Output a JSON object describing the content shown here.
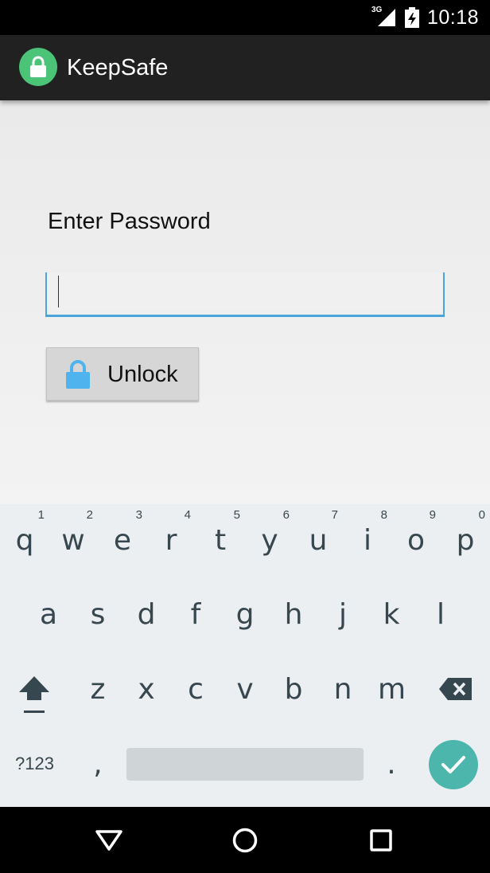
{
  "status_bar": {
    "network": "3G",
    "time": "10:18"
  },
  "app_bar": {
    "title": "KeepSafe",
    "logo_icon": "lock-icon",
    "logo_color": "#4cc478"
  },
  "unlock_screen": {
    "prompt": "Enter Password",
    "password_value": "",
    "unlock_label": "Unlock",
    "unlock_icon": "lock-icon",
    "accent_color": "#4aa3d9"
  },
  "keyboard": {
    "row1": [
      {
        "key": "q",
        "hint": "1"
      },
      {
        "key": "w",
        "hint": "2"
      },
      {
        "key": "e",
        "hint": "3"
      },
      {
        "key": "r",
        "hint": "4"
      },
      {
        "key": "t",
        "hint": "5"
      },
      {
        "key": "y",
        "hint": "6"
      },
      {
        "key": "u",
        "hint": "7"
      },
      {
        "key": "i",
        "hint": "8"
      },
      {
        "key": "o",
        "hint": "9"
      },
      {
        "key": "p",
        "hint": "0"
      }
    ],
    "row2": [
      "a",
      "s",
      "d",
      "f",
      "g",
      "h",
      "j",
      "k",
      "l"
    ],
    "row3": [
      "z",
      "x",
      "c",
      "v",
      "b",
      "n",
      "m"
    ],
    "symbols_label": "?123",
    "comma": ",",
    "period": ".",
    "enter_color": "#4db6ac"
  },
  "nav_bar": {
    "back_icon": "back-triangle-icon",
    "home_icon": "home-circle-icon",
    "recents_icon": "recents-square-icon"
  }
}
